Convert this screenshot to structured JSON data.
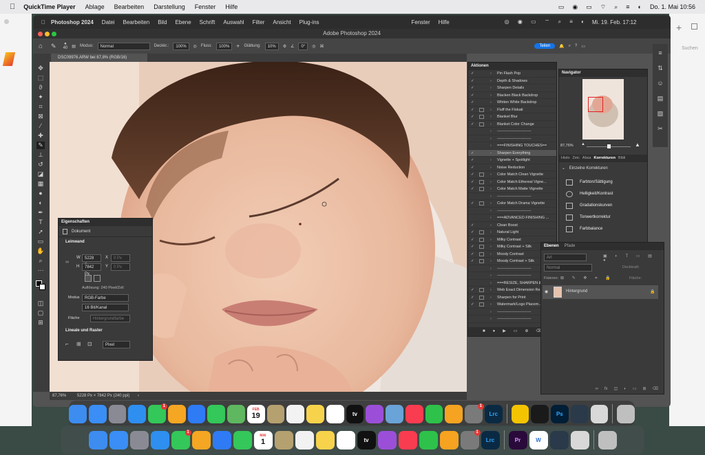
{
  "outer_menubar": {
    "app": "QuickTime Player",
    "items": [
      "Ablage",
      "Bearbeiten",
      "Darstellung",
      "Fenster",
      "Hilfe"
    ],
    "clock": "Do. 1. Mai  10:56"
  },
  "background_windows": {
    "search_label": "Suchen"
  },
  "ps_menubar": {
    "app": "Photoshop 2024",
    "items": [
      "Datei",
      "Bearbeiten",
      "Bild",
      "Ebene",
      "Schrift",
      "Auswahl",
      "Filter",
      "Ansicht",
      "Plug-ins"
    ],
    "right_items": [
      "Fenster",
      "Hilfe"
    ],
    "clock": "Mi. 19. Feb.  17:12"
  },
  "window_title": "Adobe Photoshop 2024",
  "options_bar": {
    "brush_size": "40",
    "mode_label": "Modus:",
    "mode_value": "Normal",
    "opacity_label": "Deckkr.:",
    "opacity_value": "100%",
    "flow_label": "Fluss:",
    "flow_value": "100%",
    "smoothing_label": "Glättung:",
    "smoothing_value": "10%",
    "angle_value": "0°",
    "share_label": "Teilen"
  },
  "document_tab": "DSC09976.ARW bei 87,8% (RGB/16)",
  "status_bar": {
    "zoom": "87,76%",
    "info": "5228 Px × 7842 Px (240 ppi)"
  },
  "properties": {
    "tab": "Eigenschaften",
    "doc_label": "Dokument",
    "section_canvas": "Leinwand",
    "w_label": "W",
    "w_value": "5228 Px",
    "h_label": "H",
    "h_value": "7842 Px",
    "x_label": "X",
    "y_label": "Y",
    "x_value": "0 Px",
    "y_value": "0 Px",
    "resolution": "Auflösung: 240 Pixel/Zoll",
    "mode_label": "Modus",
    "mode_value": "RGB-Farbe",
    "depth_value": "16 Bit/Kanal",
    "fill_label": "Fläche",
    "fill_value": "Hintergrundfarbe",
    "section_rulers": "Lineale und Raster",
    "unit_value": "Pixel"
  },
  "actions": {
    "tab": "Aktionen",
    "items": [
      {
        "label": "Pin Flash Pop",
        "check": true,
        "dialog": false
      },
      {
        "label": "Depth & Shadows",
        "check": true,
        "dialog": false
      },
      {
        "label": "Sharpen Details",
        "check": true,
        "dialog": false
      },
      {
        "label": "Blacken Black Backdrop",
        "check": true,
        "dialog": false
      },
      {
        "label": "Whiten White Backdrop",
        "check": true,
        "dialog": false
      },
      {
        "label": "Fluff the Flokati",
        "check": true,
        "dialog": true
      },
      {
        "label": "Blanket Blur",
        "check": true,
        "dialog": true
      },
      {
        "label": "Blanket Color Change",
        "check": true,
        "dialog": true
      },
      {
        "label": "---------------------------",
        "check": false,
        "dialog": false
      },
      {
        "label": "---------------------------",
        "check": false,
        "dialog": false
      },
      {
        "label": "===FINISHING TOUCHES==",
        "check": false,
        "dialog": false
      },
      {
        "label": "Sharpen Everything",
        "check": true,
        "dialog": false,
        "selected": true
      },
      {
        "label": "Vignette + Spotlight",
        "check": true,
        "dialog": false
      },
      {
        "label": "Noise Reduction",
        "check": true,
        "dialog": false
      },
      {
        "label": "Color Match Clean Vignette",
        "check": true,
        "dialog": true
      },
      {
        "label": "Color Match Ethereal Vigne...",
        "check": true,
        "dialog": true
      },
      {
        "label": "Color Match Matte Vignette",
        "check": true,
        "dialog": true
      },
      {
        "label": "---------------------------",
        "check": false,
        "dialog": false
      },
      {
        "label": "Color Match Drama Vignette",
        "check": true,
        "dialog": true
      },
      {
        "label": "---------------------------",
        "check": false,
        "dialog": false
      },
      {
        "label": "===ADVANCED FINISHING ...",
        "check": false,
        "dialog": false
      },
      {
        "label": "Clean Boost",
        "check": true,
        "dialog": false
      },
      {
        "label": "Natural Light",
        "check": true,
        "dialog": true
      },
      {
        "label": "Milky Contrast",
        "check": true,
        "dialog": true
      },
      {
        "label": "Milky Contrast + Silk",
        "check": true,
        "dialog": true
      },
      {
        "label": "Moody Contrast",
        "check": true,
        "dialog": true
      },
      {
        "label": "Moody Contrast + Silk",
        "check": true,
        "dialog": true
      },
      {
        "label": "---------------------------",
        "check": false,
        "dialog": false
      },
      {
        "label": "---------------------------",
        "check": false,
        "dialog": false
      },
      {
        "label": "===RESIZE, SHARPEN & ...",
        "check": false,
        "dialog": false
      },
      {
        "label": "Web Exact Dimension Re...",
        "check": true,
        "dialog": true
      },
      {
        "label": "Sharpen for Print",
        "check": true,
        "dialog": true
      },
      {
        "label": "Watermark/Logo Placem...",
        "check": true,
        "dialog": true
      },
      {
        "label": "---------------------------",
        "check": false,
        "dialog": false
      },
      {
        "label": "---------------------------",
        "check": false,
        "dialog": false
      }
    ]
  },
  "navigator": {
    "tab": "Navigator",
    "zoom": "87,76%",
    "subtabs": [
      "Histo",
      "Zeic",
      "Absa",
      "Korrekturen",
      "Bibli"
    ],
    "active_subtab": "Korrekturen",
    "group_label": "Einzelne Korrekturen",
    "adjustments": [
      "Farbton/Sättigung",
      "Helligkeit/Kontrast",
      "Gradationskurven",
      "Tonwertkorrektur",
      "Farbbalance"
    ]
  },
  "layers": {
    "tabs": [
      "Ebenen",
      "Pfade"
    ],
    "filter_label": "Art",
    "blend_mode": "Normal",
    "opacity_label": "Deckkraft:",
    "lock_label": "Fixieren:",
    "fill_label": "Fläche:",
    "layer_name": "Hintergrund"
  },
  "dock_top": [
    "Finder",
    "Mail",
    "Launchpad",
    "Safari",
    "Nachrichten",
    "Fotos",
    "Keynote",
    "FaceTime",
    "Karten",
    "Kalender",
    "Notizen-App",
    "Erinnerungen",
    "Notizen",
    "Freeform",
    "TV",
    "Podcasts",
    "Migration",
    "Musik",
    "Numbers",
    "Pages",
    "Systemeinstellungen",
    "Lightroom",
    "Sketch",
    "Aktivität",
    "Photoshop",
    "QuickTime",
    "Vorschau",
    "Papierkorb"
  ],
  "dock_bottom": [
    "Finder",
    "Mail",
    "Launchpad",
    "Safari",
    "Nachrichten",
    "Fotos",
    "Keynote",
    "FaceTime",
    "Kalender",
    "Notizen-App",
    "Erinnerungen",
    "Notizen",
    "Freeform",
    "TV",
    "Podcasts",
    "Musik",
    "Numbers",
    "Pages",
    "Systemeinstellungen",
    "Lightroom",
    "Premiere",
    "Word",
    "QuickTime",
    "Vorschau",
    "Papierkorb"
  ],
  "dock_labels": {
    "calendar_top_month": "FEB",
    "calendar_top_day": "19",
    "calendar_bottom_month": "MAI",
    "calendar_bottom_day": "1",
    "tv": "tv",
    "lrc": "Lrc",
    "ps": "Ps",
    "pr": "Pr",
    "w": "W"
  },
  "colors": {
    "ps_bg": "#535353",
    "panel": "#3a3a3a",
    "accent": "#1473e6"
  }
}
